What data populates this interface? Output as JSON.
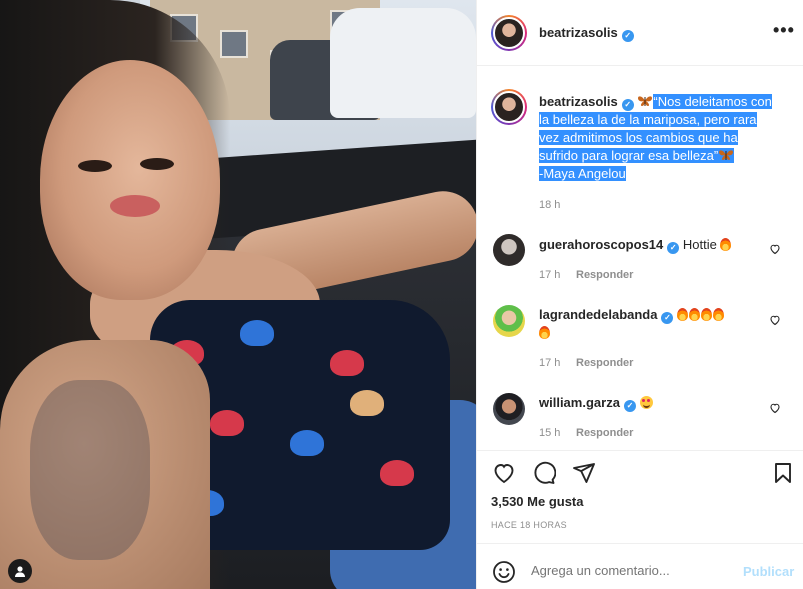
{
  "post": {
    "author": "beatrizasolis",
    "caption_plain_prefix": "",
    "caption_selected": "“Nos deleitamos con la belleza la de la mariposa, pero rara vez admitimos los cambios que ha sufrido para lograr esa belleza”",
    "caption_selected_tail": "-Maya Angelou",
    "caption_time": "18 h",
    "comments": [
      {
        "user": "gueraho​roscopos14",
        "text": "Hottie",
        "time": "17 h",
        "reply": "Responder",
        "fires": 1
      },
      {
        "user": "lagrandedelabanda",
        "text": "",
        "time": "17 h",
        "reply": "Responder",
        "fires": 5
      },
      {
        "user": "william.garza",
        "text": "",
        "time": "15 h",
        "reply": "Responder",
        "fires": 0
      }
    ],
    "likes": "3,530 Me gusta",
    "posted_ago": "HACE 18 HORAS",
    "comment_placeholder": "Agrega un comentario...",
    "publish_label": "Publicar"
  },
  "colors": {
    "verified": "#3897f0",
    "selection": "#3390ff",
    "publish_disabled": "#b2dffc"
  }
}
